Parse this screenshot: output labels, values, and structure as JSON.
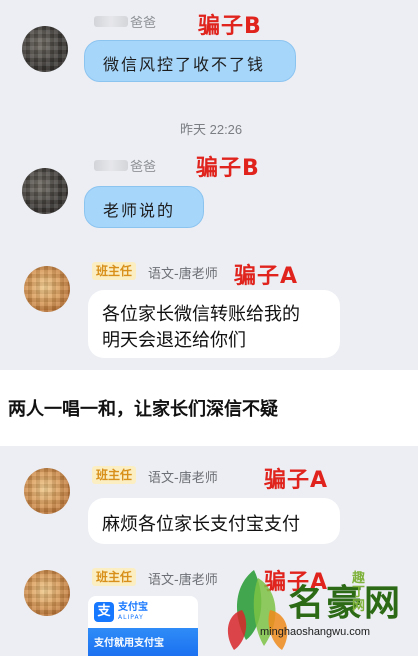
{
  "panel1": {
    "msg1": {
      "sender": "爸爸",
      "tag": "骗子B",
      "text": "微信风控了收不了钱"
    },
    "timestamp": "昨天 22:26",
    "msg2": {
      "sender": "爸爸",
      "tag": "骗子B",
      "text": "老师说的"
    },
    "msg3": {
      "badge": "班主任",
      "sender": "语文-唐老师",
      "tag": "骗子A",
      "line1": "各位家长微信转账给我的",
      "line2": "明天会退还给你们"
    }
  },
  "caption": "两人一唱一和，让家长们深信不疑",
  "panel2": {
    "msg1": {
      "badge": "班主任",
      "sender": "语文-唐老师",
      "tag": "骗子A",
      "text": "麻烦各位家长支付宝支付"
    },
    "msg2": {
      "badge": "班主任",
      "sender": "语文-唐老师",
      "tag": "骗子A",
      "alipay": {
        "logo": "支",
        "title": "支付宝",
        "subtitle": "ALIPAY",
        "bar": "支付就用支付宝"
      }
    }
  },
  "watermark": {
    "title": "名豪网",
    "url": "minghaoshangwu.com",
    "side": "趣丁网"
  },
  "colors": {
    "scam_label": "#e0231c",
    "blue_bubble": "#a7d6fb",
    "badge_bg": "#fbeec3",
    "badge_text": "#d8901a"
  }
}
